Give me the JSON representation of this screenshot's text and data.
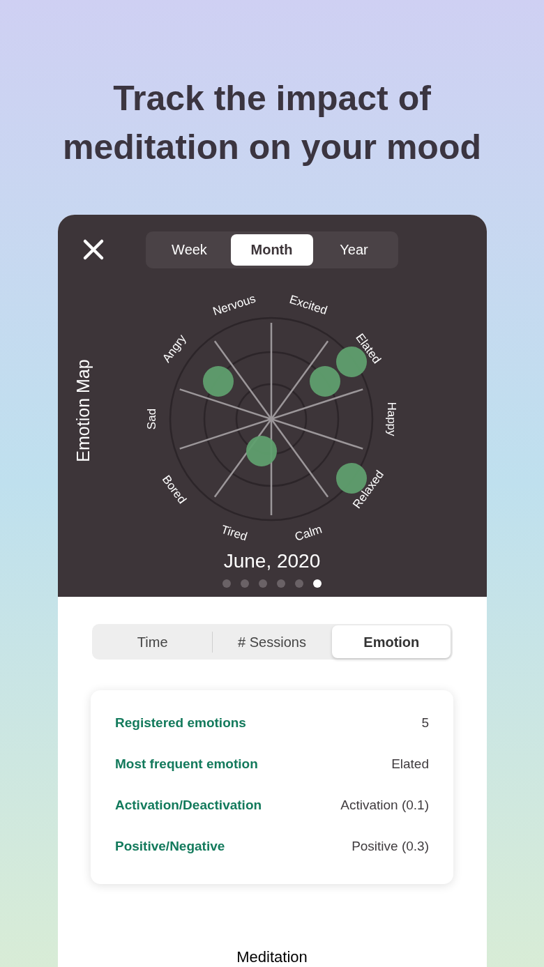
{
  "headline_lines": [
    "Track the impact of",
    "meditation on your mood"
  ],
  "period_tabs": [
    {
      "label": "Week",
      "selected": false
    },
    {
      "label": "Month",
      "selected": true
    },
    {
      "label": "Year",
      "selected": false
    }
  ],
  "chart_title": "Emotion Map",
  "emotions": [
    "Nervous",
    "Excited",
    "Elated",
    "Happy",
    "Relaxed",
    "Calm",
    "Tired",
    "Bored",
    "Sad",
    "Angry"
  ],
  "date": "June, 2020",
  "pages": [
    {
      "selected": false
    },
    {
      "selected": false
    },
    {
      "selected": false
    },
    {
      "selected": false
    },
    {
      "selected": false
    },
    {
      "selected": true
    }
  ],
  "metric_tabs": [
    {
      "label": "Time",
      "selected": false
    },
    {
      "label": "# Sessions",
      "selected": false
    },
    {
      "label": "Emotion",
      "selected": true
    }
  ],
  "stats": [
    {
      "label": "Registered emotions",
      "value": "5"
    },
    {
      "label": "Most frequent emotion",
      "value": "Elated"
    },
    {
      "label": "Activation/Deactivation",
      "value": "Activation (0.1)"
    },
    {
      "label": "Positive/Negative",
      "value": "Positive (0.3)"
    }
  ],
  "section_title": "Meditation"
}
